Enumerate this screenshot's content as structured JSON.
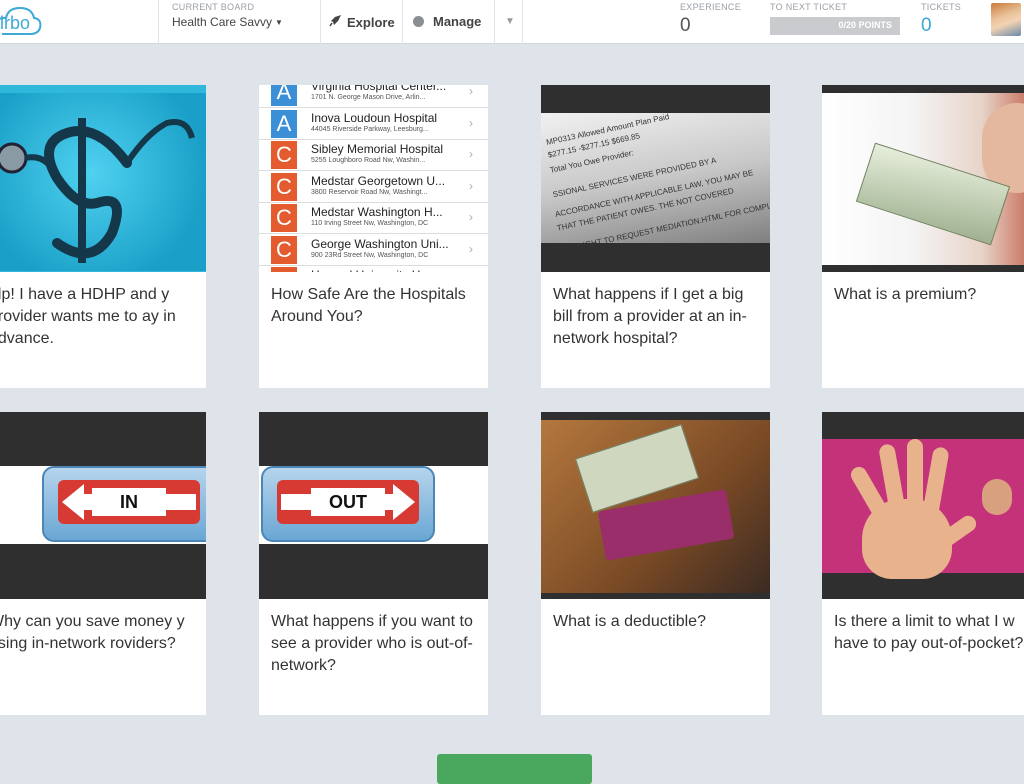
{
  "app": {
    "logo_text": "irbo"
  },
  "board": {
    "label": "CURRENT BOARD",
    "name": "Health Care Savvy"
  },
  "nav": {
    "explore": "Explore",
    "manage": "Manage"
  },
  "stats": {
    "experience_label": "EXPERIENCE",
    "experience_value": "0",
    "next_ticket_label": "TO NEXT TICKET",
    "next_ticket_progress": "0/20 POINTS",
    "next_ticket_fraction": 0,
    "tickets_label": "TICKETS",
    "tickets_value": "0"
  },
  "colors": {
    "accent": "#3aa7d6",
    "button": "#49a85e",
    "background": "#dfe3ea"
  },
  "cards": [
    {
      "title": "elp! I have a HDHP and y provider wants me to ay in advance."
    },
    {
      "title": "How Safe Are the Hospitals Around You?"
    },
    {
      "title": "What happens if I get a big bill from a provider at an in-network hospital?"
    },
    {
      "title": "What is a premium?"
    },
    {
      "title": "Why can you save money y using in-network roviders?"
    },
    {
      "title": "What happens if you want to see a provider who is out-of-network?"
    },
    {
      "title": "What is a deductible?"
    },
    {
      "title": "Is there a limit to what I w have to pay out-of-pocket?"
    }
  ],
  "hospitals": [
    {
      "letter": "A",
      "name": "Virginia Hospital Center...",
      "address": "1701 N. George Mason Drive, Arlin..."
    },
    {
      "letter": "A",
      "name": "Inova Loudoun Hospital",
      "address": "44045 Riverside Parkway, Leesburg..."
    },
    {
      "letter": "C",
      "name": "Sibley Memorial Hospital",
      "address": "5255 Loughboro Road Nw, Washin..."
    },
    {
      "letter": "C",
      "name": "Medstar Georgetown U...",
      "address": "3800 Reservoir Road Nw, Washingt..."
    },
    {
      "letter": "C",
      "name": "Medstar Washington H...",
      "address": "110 Irving Street Nw, Washington, DC"
    },
    {
      "letter": "C",
      "name": "George Washington Uni...",
      "address": "900 23Rd Street Nw, Washington, DC"
    },
    {
      "letter": "D",
      "name": "Howard University Hos...",
      "address": ""
    }
  ],
  "letter_colors": {
    "A": "#3a8fd6",
    "C": "#e35b2f",
    "D": "#e35b2f"
  },
  "signs": {
    "in": "IN",
    "out": "OUT"
  },
  "bill_lines": [
    "MP0313   Allowed Amount   Plan Paid",
    "$277.15   -$277.15   $669.85",
    "Total You Owe Provider:",
    "SSIONAL SERVICES WERE PROVIDED BY A",
    "ACCORDANCE WITH APPLICABLE LAW, YOU MAY BE",
    "THAT THE PATIENT OWES. THE NOT COVERED",
    "THE RIGHT TO REQUEST MEDIATION.HTML FOR COMPLAINTS"
  ],
  "footer_button": ""
}
